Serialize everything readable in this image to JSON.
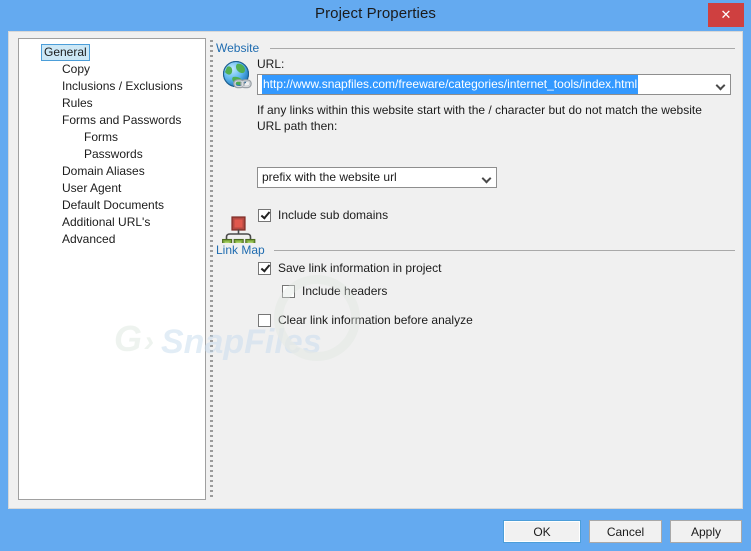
{
  "window": {
    "title": "Project Properties",
    "close_label": "✕",
    "close_icon": "close-icon"
  },
  "sidebar": {
    "items": [
      {
        "label": "General",
        "indent": 0,
        "selected": true,
        "arrow": "expanded"
      },
      {
        "label": "Copy",
        "indent": 1,
        "selected": false,
        "arrow": "none"
      },
      {
        "label": "Inclusions / Exclusions",
        "indent": 1,
        "selected": false,
        "arrow": "none"
      },
      {
        "label": "Rules",
        "indent": 1,
        "selected": false,
        "arrow": "none"
      },
      {
        "label": "Forms and Passwords",
        "indent": 1,
        "selected": false,
        "arrow": "expanded"
      },
      {
        "label": "Forms",
        "indent": 2,
        "selected": false,
        "arrow": "none"
      },
      {
        "label": "Passwords",
        "indent": 2,
        "selected": false,
        "arrow": "none"
      },
      {
        "label": "Domain Aliases",
        "indent": 1,
        "selected": false,
        "arrow": "none"
      },
      {
        "label": "User Agent",
        "indent": 1,
        "selected": false,
        "arrow": "none"
      },
      {
        "label": "Default Documents",
        "indent": 1,
        "selected": false,
        "arrow": "none"
      },
      {
        "label": "Additional URL's",
        "indent": 1,
        "selected": false,
        "arrow": "none"
      },
      {
        "label": "Advanced",
        "indent": 1,
        "selected": false,
        "arrow": "none"
      }
    ]
  },
  "website_group": {
    "title": "Website",
    "icon": "globe-link-icon",
    "url_label": "URL:",
    "url_value": "http://www.snapfiles.com/freeware/categories/internet_tools/index.html",
    "url_selected": true,
    "hint_text": "If any links within this website start with the / character but do not match the website URL path then:",
    "prefix_select_value": "prefix with the website url",
    "include_sub_domains": {
      "label": "Include sub domains",
      "checked": true
    }
  },
  "linkmap_group": {
    "title": "Link Map",
    "icon": "link-map-icon",
    "save_link_info": {
      "label": "Save link information in project",
      "checked": true
    },
    "include_headers": {
      "label": "Include headers",
      "checked": false
    },
    "clear_link_info": {
      "label": "Clear link information before analyze",
      "checked": false
    }
  },
  "buttons": {
    "ok": "OK",
    "cancel": "Cancel",
    "apply": "Apply"
  },
  "watermark": {
    "text": "SnapFiles"
  },
  "colors": {
    "titlebar": "#64aaf0",
    "close": "#cf4040",
    "group_label": "#1f6cb0",
    "selection": "#3399ff",
    "tree_selection": "#cde8f6",
    "content_bg": "#f0f0f0"
  }
}
